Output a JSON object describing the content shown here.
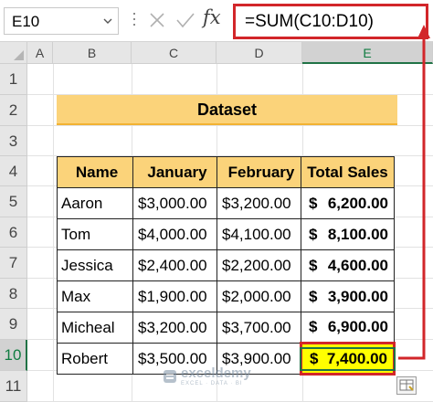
{
  "formula_bar": {
    "name_box": "E10",
    "fx_label": "fx",
    "formula": "=SUM(C10:D10)"
  },
  "columns": [
    "A",
    "B",
    "C",
    "D",
    "E"
  ],
  "rows": [
    "1",
    "2",
    "3",
    "4",
    "5",
    "6",
    "7",
    "8",
    "9",
    "10",
    "11"
  ],
  "selected_cell": {
    "column": "E",
    "row": "10"
  },
  "dataset_title": "Dataset",
  "table": {
    "headers": [
      "Name",
      "January",
      "February",
      "Total Sales"
    ],
    "rows": [
      {
        "name": "Aaron",
        "jan": "$3,000.00",
        "feb": "$3,200.00",
        "cur": "$",
        "total": "6,200.00"
      },
      {
        "name": "Tom",
        "jan": "$4,000.00",
        "feb": "$4,100.00",
        "cur": "$",
        "total": "8,100.00"
      },
      {
        "name": "Jessica",
        "jan": "$2,400.00",
        "feb": "$2,200.00",
        "cur": "$",
        "total": "4,600.00"
      },
      {
        "name": "Max",
        "jan": "$1,900.00",
        "feb": "$2,000.00",
        "cur": "$",
        "total": "3,900.00"
      },
      {
        "name": "Micheal",
        "jan": "$3,200.00",
        "feb": "$3,700.00",
        "cur": "$",
        "total": "6,900.00"
      },
      {
        "name": "Robert",
        "jan": "$3,500.00",
        "feb": "$3,900.00",
        "cur": "$",
        "total": "7,400.00"
      }
    ]
  },
  "watermark": {
    "name": "exceldemy",
    "tagline": "EXCEL · DATA · BI"
  },
  "colors": {
    "header_fill": "#fbd37a",
    "highlight_fill": "#ffff00",
    "annotation_red": "#d2262a",
    "excel_green": "#217346"
  },
  "icons": {
    "cancel": "close-icon",
    "enter": "check-icon",
    "function": "fx-icon",
    "quick_analysis": "quick-analysis-icon"
  }
}
